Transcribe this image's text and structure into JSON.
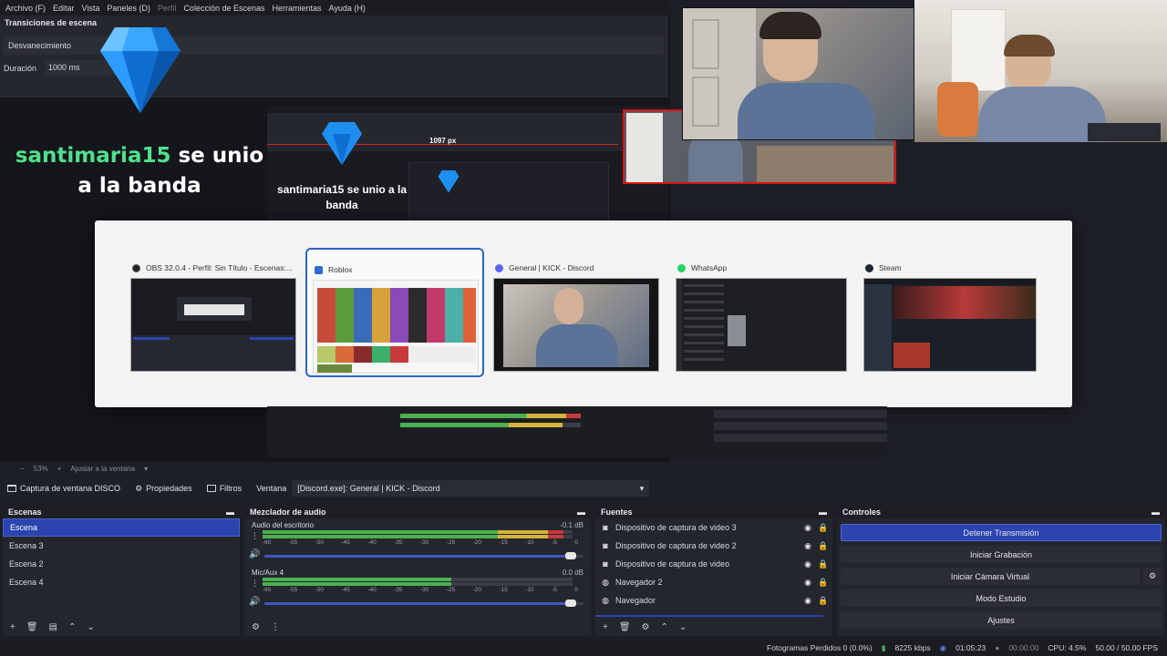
{
  "menu": [
    "Archivo (F)",
    "Editar",
    "Vista",
    "Paneles (D)",
    "Perfil",
    "Colección de Escenas",
    "Herramientas",
    "Ayuda (H)"
  ],
  "transitions": {
    "title": "Transiciones de escena",
    "selected": "Desvanecimiento",
    "duration_label": "Duración",
    "duration_value": "1000 ms"
  },
  "alert": {
    "user": "santimaria15",
    "message_rest": " se unio a la banda"
  },
  "nested": {
    "pixel_label": "1097 px",
    "mini_alert": "santimaria15 se unio a la banda"
  },
  "switcher": {
    "items": [
      {
        "title": "OBS 32.0.4 - Perfil: Sin Título - Escenas:...",
        "icon": "obs-icon",
        "selected": false
      },
      {
        "title": "Roblox",
        "icon": "roblox-icon",
        "selected": true
      },
      {
        "title": "General | KICK - Discord",
        "icon": "discord-icon",
        "selected": false
      },
      {
        "title": "WhatsApp",
        "icon": "whatsapp-icon",
        "selected": false
      },
      {
        "title": "Steam",
        "icon": "steam-icon",
        "selected": false
      }
    ]
  },
  "zoom": {
    "value": "53%",
    "fit": "Ajustar a la ventana"
  },
  "source_toolbar": {
    "source_name": "Captura de ventana DISCO",
    "properties": "Propiedades",
    "filters": "Filtros",
    "window_label": "Ventana",
    "window_value": "[Discord.exe]: General | KICK - Discord"
  },
  "scenes": {
    "title": "Escenas",
    "items": [
      "Escena",
      "Escena 3",
      "Escena 2",
      "Escena 4"
    ]
  },
  "mixer": {
    "title": "Mezclador de audio",
    "channels": [
      {
        "name": "Audio del escritorio",
        "db": "-0.1 dB",
        "level": 0.97,
        "volume": 1.0
      },
      {
        "name": "Mic/Aux 4",
        "db": "0.0 dB",
        "level": 0.61,
        "volume": 1.0
      }
    ],
    "scale": [
      "-60",
      "-55",
      "-50",
      "-45",
      "-40",
      "-35",
      "-30",
      "-25",
      "-20",
      "-15",
      "-10",
      "-5",
      "0"
    ]
  },
  "sources": {
    "title": "Fuentes",
    "items": [
      {
        "name": "Dispositivo de captura de video 3",
        "icon": "camera-icon"
      },
      {
        "name": "Dispositivo de captura de video 2",
        "icon": "camera-icon"
      },
      {
        "name": "Dispositivo de captura de video",
        "icon": "camera-icon"
      },
      {
        "name": "Navegador 2",
        "icon": "globe-icon"
      },
      {
        "name": "Navegador",
        "icon": "globe-icon"
      }
    ]
  },
  "controls": {
    "title": "Controles",
    "stop_stream": "Detener Transmisión",
    "start_record": "Iniciar Grabación",
    "start_virtual_cam": "Iniciar Cámara Virtual",
    "studio_mode": "Modo Estudio",
    "settings": "Ajustes"
  },
  "status": {
    "dropped": "Fotogramas Perdidos 0 (0.0%)",
    "bitrate": "8225 kbps",
    "stream_time": "01:05:23",
    "record_time": "00:00:00",
    "cpu": "CPU: 4.5%",
    "fps": "50.00 / 50.00 FPS"
  },
  "colors": {
    "accent": "#2b44b0",
    "alert_user": "#4fe08b",
    "meter_green": "#4caf50",
    "meter_yellow": "#d4b33a",
    "meter_red": "#c83a3a"
  }
}
